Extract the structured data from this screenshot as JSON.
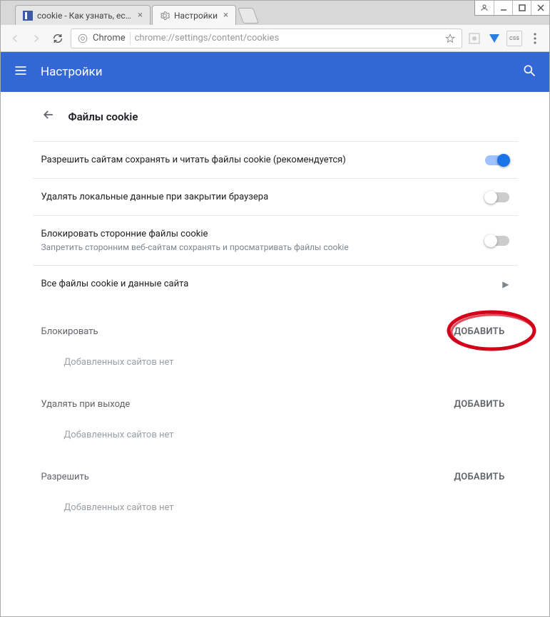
{
  "window_controls": [
    "user",
    "min",
    "max",
    "close"
  ],
  "tabs": [
    {
      "title": "cookie - Как узнать, есть",
      "active": false
    },
    {
      "title": "Настройки",
      "active": true
    }
  ],
  "addressbar": {
    "browser_label": "Chrome",
    "url": "chrome://settings/content/cookies"
  },
  "header": {
    "title": "Настройки"
  },
  "page": {
    "back_title": "Файлы cookie",
    "settings": [
      {
        "label": "Разрешить сайтам сохранять и читать файлы cookie (рекомендуется)",
        "sub": "",
        "on": true
      },
      {
        "label": "Удалять локальные данные при закрытии браузера",
        "sub": "",
        "on": false
      },
      {
        "label": "Блокировать сторонние файлы cookie",
        "sub": "Запретить сторонним веб-сайтам сохранять и просматривать файлы cookie",
        "on": false
      }
    ],
    "nav_row": "Все файлы cookie и данные сайта",
    "sections": [
      {
        "title": "Блокировать",
        "add": "ДОБАВИТЬ",
        "empty": "Добавленных сайтов нет"
      },
      {
        "title": "Удалять при выходе",
        "add": "ДОБАВИТЬ",
        "empty": "Добавленных сайтов нет"
      },
      {
        "title": "Разрешить",
        "add": "ДОБАВИТЬ",
        "empty": "Добавленных сайтов нет"
      }
    ]
  }
}
